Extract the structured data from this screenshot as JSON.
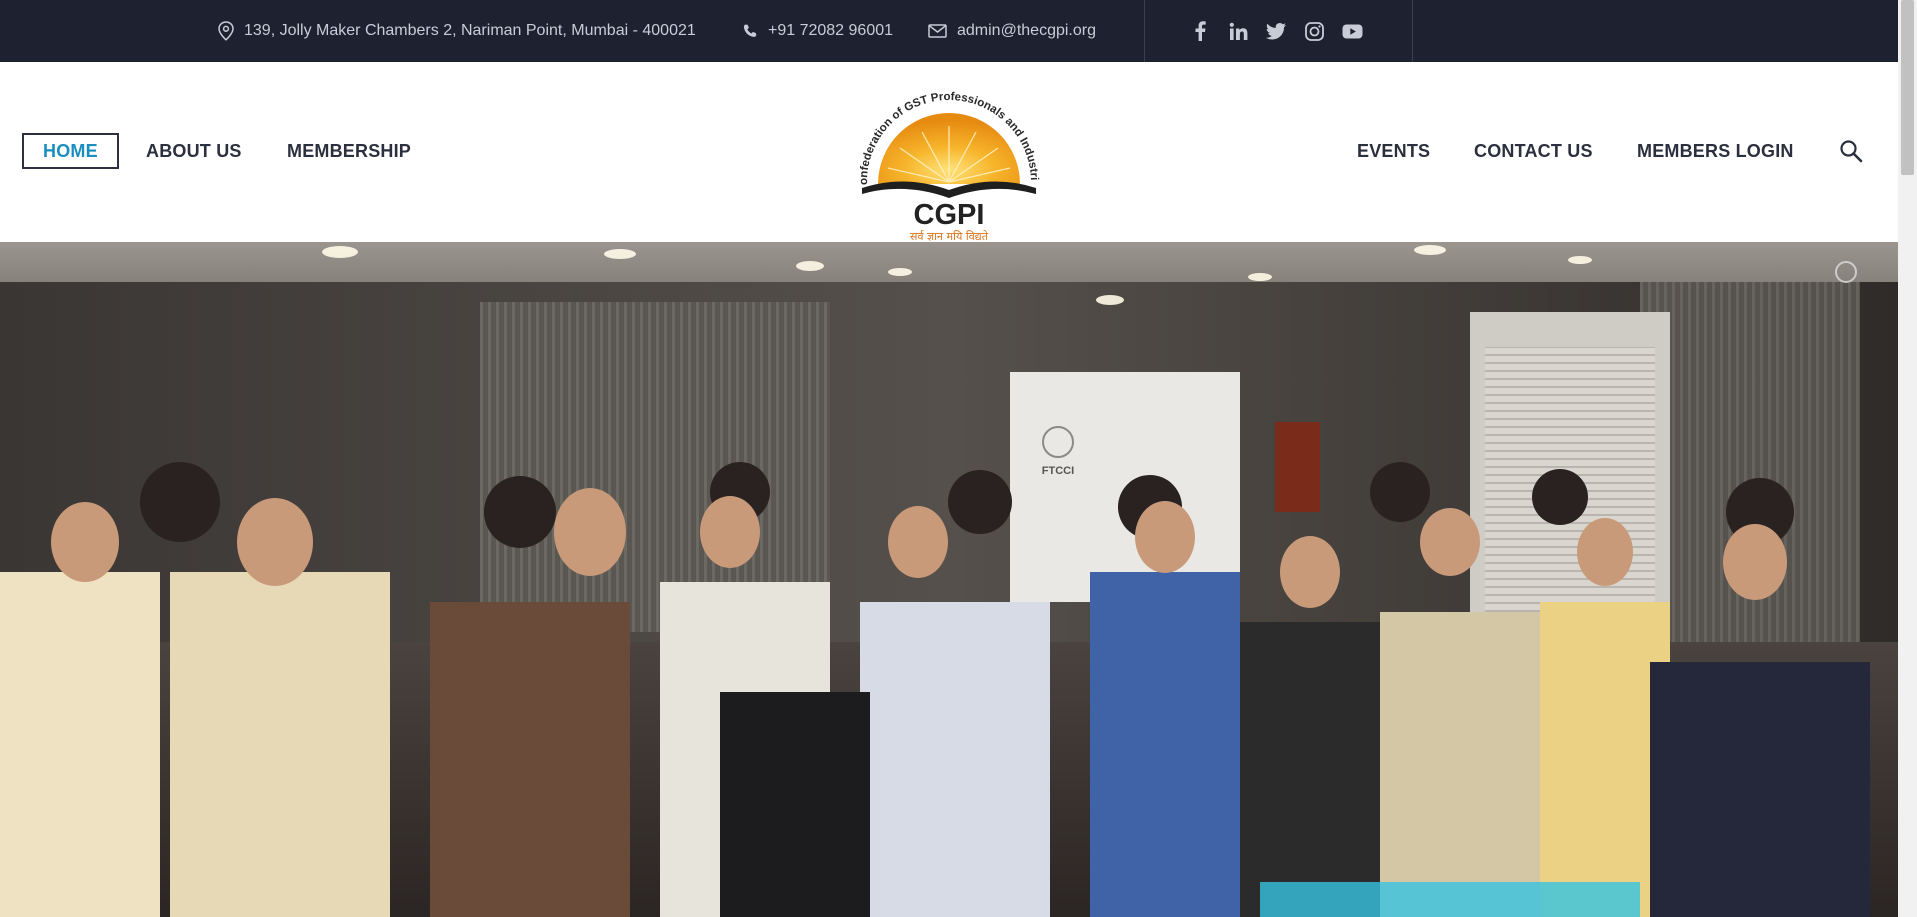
{
  "topbar": {
    "address": "139, Jolly Maker Chambers 2, Nariman Point, Mumbai - 400021",
    "phone": "+91 72082 96001",
    "email": "admin@thecgpi.org",
    "social_icons": [
      "facebook-icon",
      "linkedin-icon",
      "twitter-icon",
      "instagram-icon",
      "youtube-icon"
    ]
  },
  "nav": {
    "home": "HOME",
    "about": "ABOUT US",
    "membership": "MEMBERSHIP",
    "events": "EVENTS",
    "contact": "CONTACT US",
    "login": "MEMBERS LOGIN"
  },
  "logo": {
    "arc_text": "Confederation of GST Professionals and Industries",
    "name": "CGPI",
    "motto": "सर्व ज्ञान मयि विद्यते"
  },
  "hero": {
    "wall_sign": "FTCCI"
  },
  "colors": {
    "topbar_bg": "#1e2130",
    "nav_text": "#2c2f3d",
    "nav_active": "#1a8fbf",
    "logo_orange": "#f0a51f"
  }
}
